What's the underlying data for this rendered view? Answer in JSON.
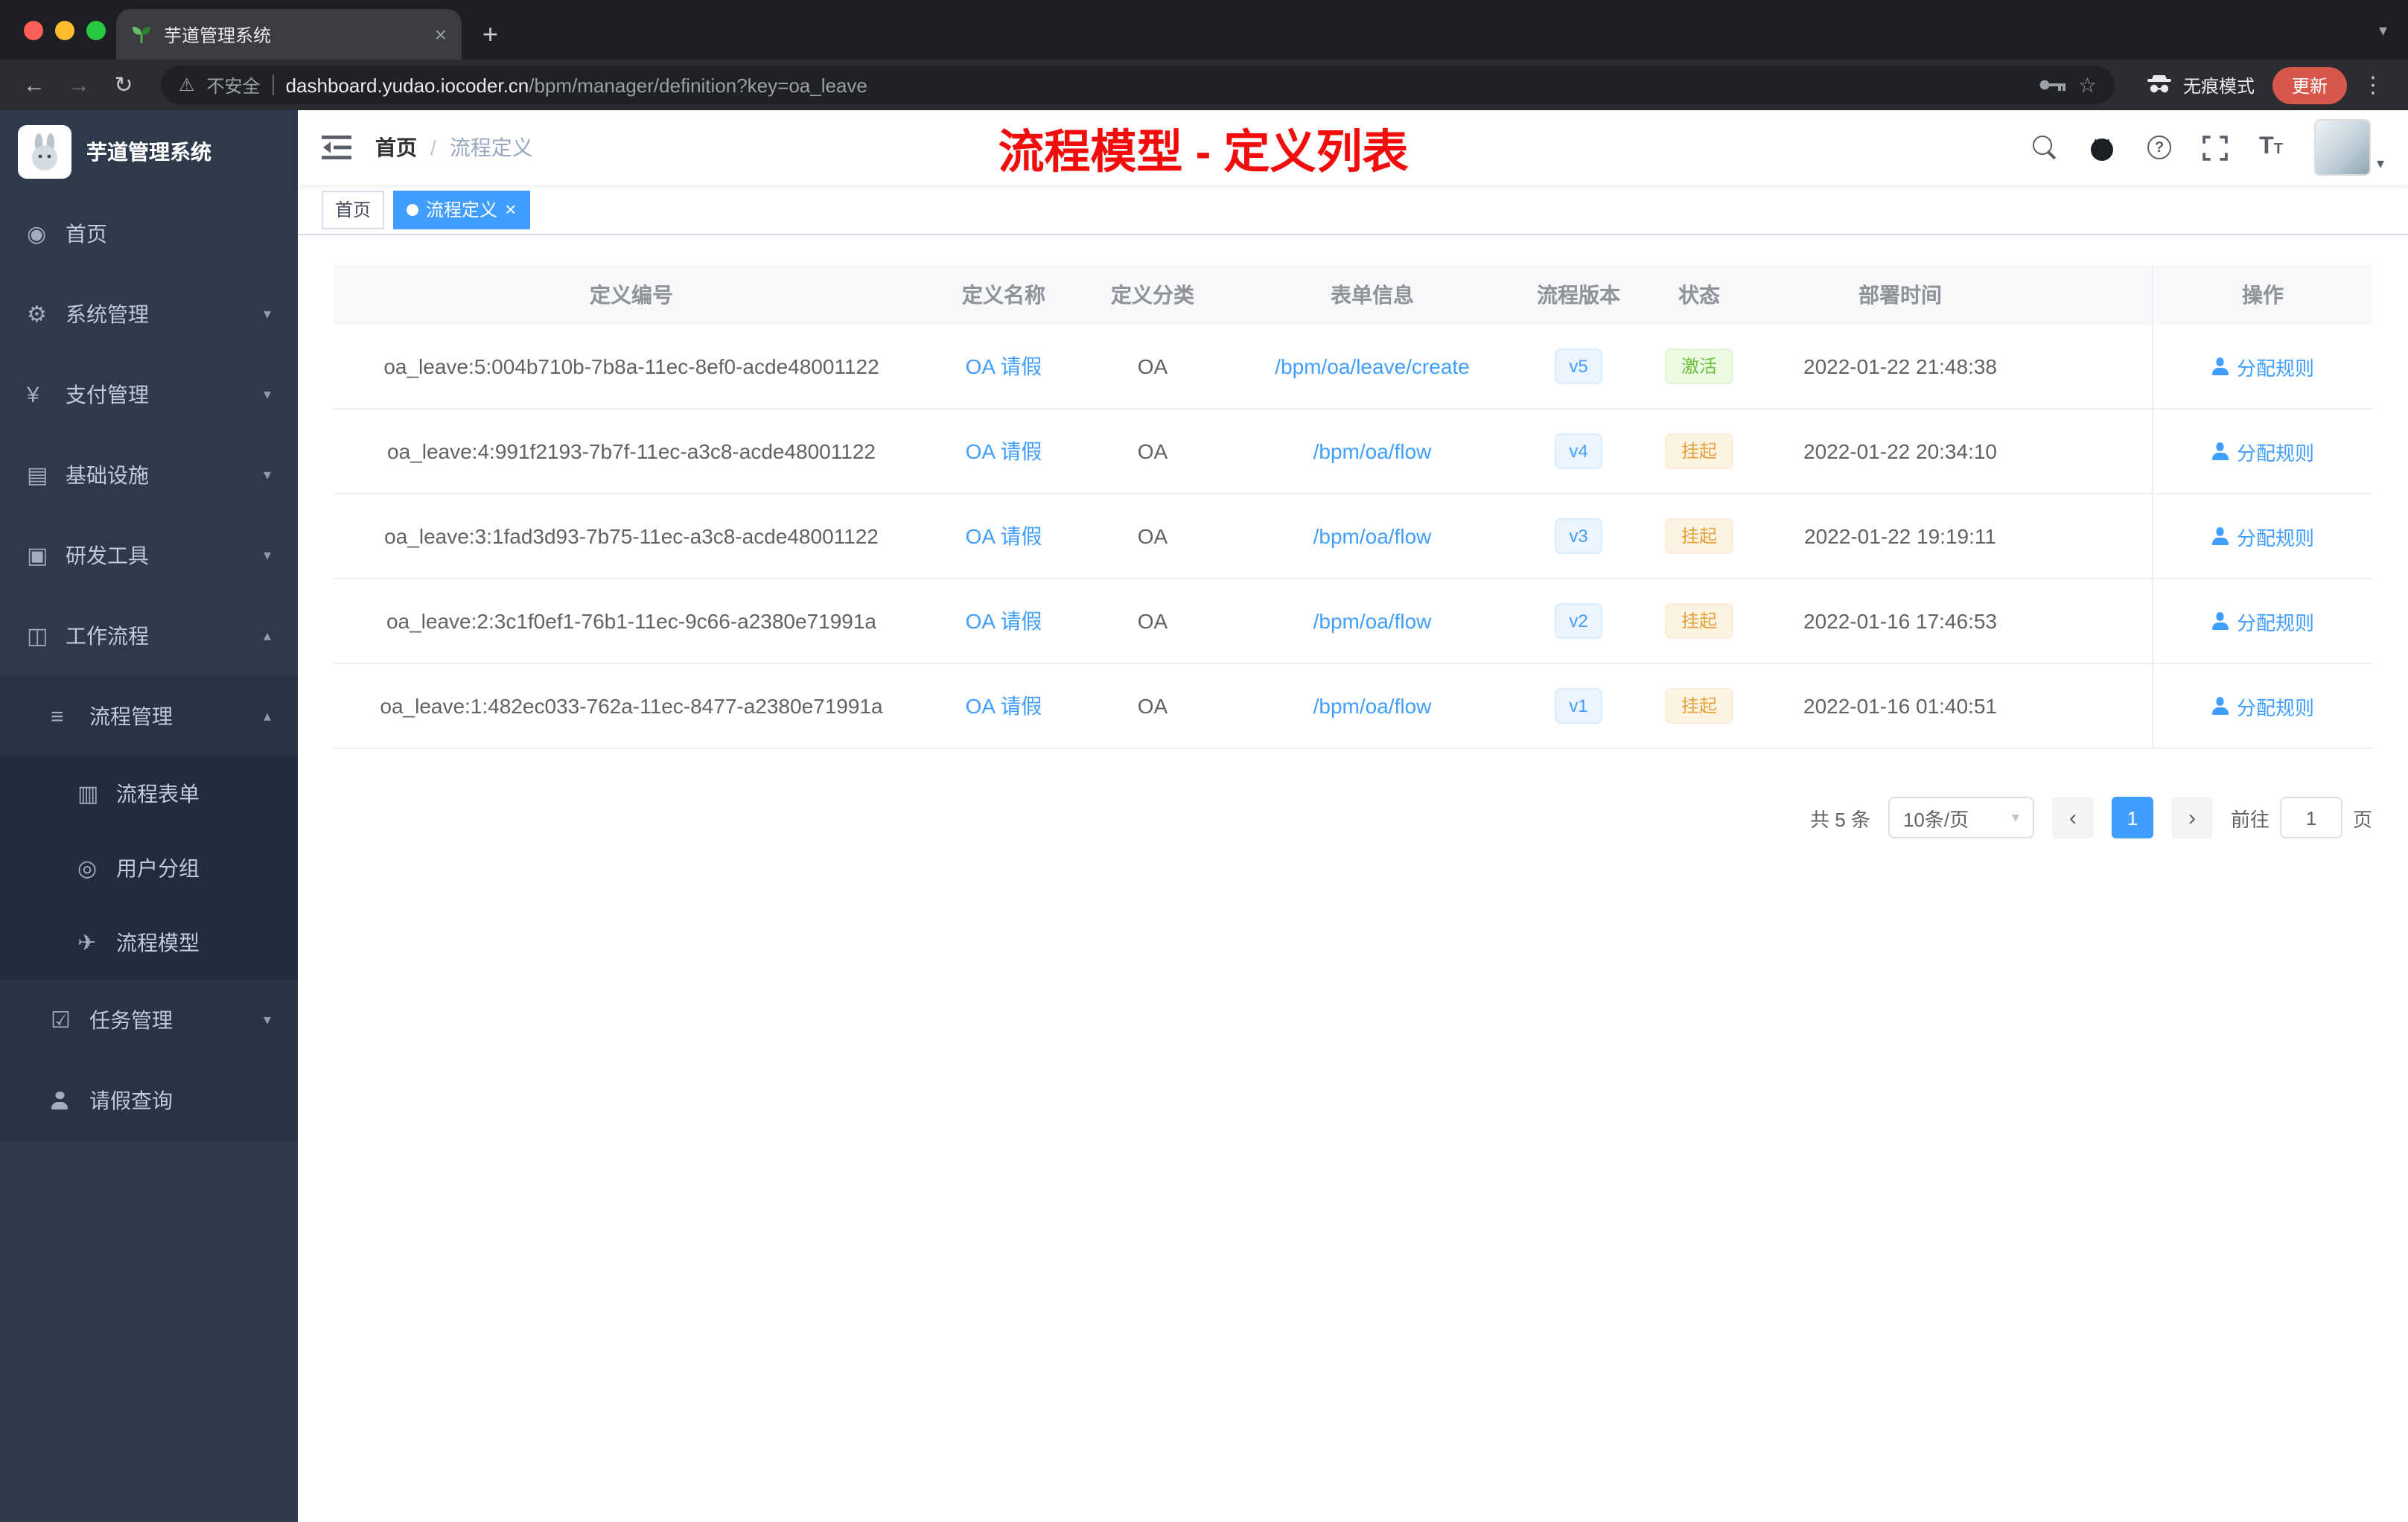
{
  "browser": {
    "tab_title": "芋道管理系统",
    "security_label": "不安全",
    "url_domain": "dashboard.yudao.iocoder.cn",
    "url_path": "/bpm/manager/definition?key=oa_leave",
    "incognito_label": "无痕模式",
    "update_label": "更新"
  },
  "sidebar": {
    "logo_title": "芋道管理系统",
    "menu": [
      {
        "label": "首页"
      },
      {
        "label": "系统管理"
      },
      {
        "label": "支付管理"
      },
      {
        "label": "基础设施"
      },
      {
        "label": "研发工具"
      },
      {
        "label": "工作流程"
      },
      {
        "label": "流程管理"
      },
      {
        "label": "流程表单"
      },
      {
        "label": "用户分组"
      },
      {
        "label": "流程模型"
      },
      {
        "label": "任务管理"
      },
      {
        "label": "请假查询"
      }
    ]
  },
  "header": {
    "breadcrumb": {
      "home": "首页",
      "separator": "/",
      "current": "流程定义"
    },
    "annotation": "流程模型 - 定义列表"
  },
  "tags": [
    {
      "label": "首页"
    },
    {
      "label": "流程定义"
    }
  ],
  "table": {
    "columns": [
      "定义编号",
      "定义名称",
      "定义分类",
      "表单信息",
      "流程版本",
      "状态",
      "部署时间",
      "操作"
    ],
    "rows": [
      {
        "id": "oa_leave:5:004b710b-7b8a-11ec-8ef0-acde48001122",
        "name": "OA 请假",
        "category": "OA",
        "form": "/bpm/oa/leave/create",
        "version": "v5",
        "status": "激活",
        "status_type": "success",
        "deploy_time": "2022-01-22 21:48:38",
        "action": "分配规则"
      },
      {
        "id": "oa_leave:4:991f2193-7b7f-11ec-a3c8-acde48001122",
        "name": "OA 请假",
        "category": "OA",
        "form": "/bpm/oa/flow",
        "version": "v4",
        "status": "挂起",
        "status_type": "warning",
        "deploy_time": "2022-01-22 20:34:10",
        "action": "分配规则"
      },
      {
        "id": "oa_leave:3:1fad3d93-7b75-11ec-a3c8-acde48001122",
        "name": "OA 请假",
        "category": "OA",
        "form": "/bpm/oa/flow",
        "version": "v3",
        "status": "挂起",
        "status_type": "warning",
        "deploy_time": "2022-01-22 19:19:11",
        "action": "分配规则"
      },
      {
        "id": "oa_leave:2:3c1f0ef1-76b1-11ec-9c66-a2380e71991a",
        "name": "OA 请假",
        "category": "OA",
        "form": "/bpm/oa/flow",
        "version": "v2",
        "status": "挂起",
        "status_type": "warning",
        "deploy_time": "2022-01-16 17:46:53",
        "action": "分配规则"
      },
      {
        "id": "oa_leave:1:482ec033-762a-11ec-8477-a2380e71991a",
        "name": "OA 请假",
        "category": "OA",
        "form": "/bpm/oa/flow",
        "version": "v1",
        "status": "挂起",
        "status_type": "warning",
        "deploy_time": "2022-01-16 01:40:51",
        "action": "分配规则"
      }
    ]
  },
  "pagination": {
    "total": "共 5 条",
    "page_size": "10条/页",
    "prev": "‹",
    "page": "1",
    "next": "›",
    "goto_label": "前往",
    "goto_value": "1",
    "page_unit": "页"
  },
  "icons": {
    "dashboard": "◉",
    "gear": "⚙",
    "yen": "¥",
    "infra": "▤",
    "tools": "▣",
    "workflow": "◫",
    "process": "≡",
    "form": "▥",
    "group": "◎",
    "model": "✈",
    "task": "☑",
    "chevron_down": "▾",
    "chevron_up": "▴",
    "close": "×",
    "plus": "+",
    "back": "←",
    "forward": "→",
    "reload": "↻",
    "warning": "⚠",
    "star": "☆",
    "kebab": "⋮",
    "caret": "▾",
    "dot_sep": "|"
  },
  "colors": {
    "accent": "#409eff",
    "success": "#67c23a",
    "warning": "#e6a23c",
    "annotation": "#f20d0d",
    "sidebar_bg": "#2d3a4b"
  }
}
